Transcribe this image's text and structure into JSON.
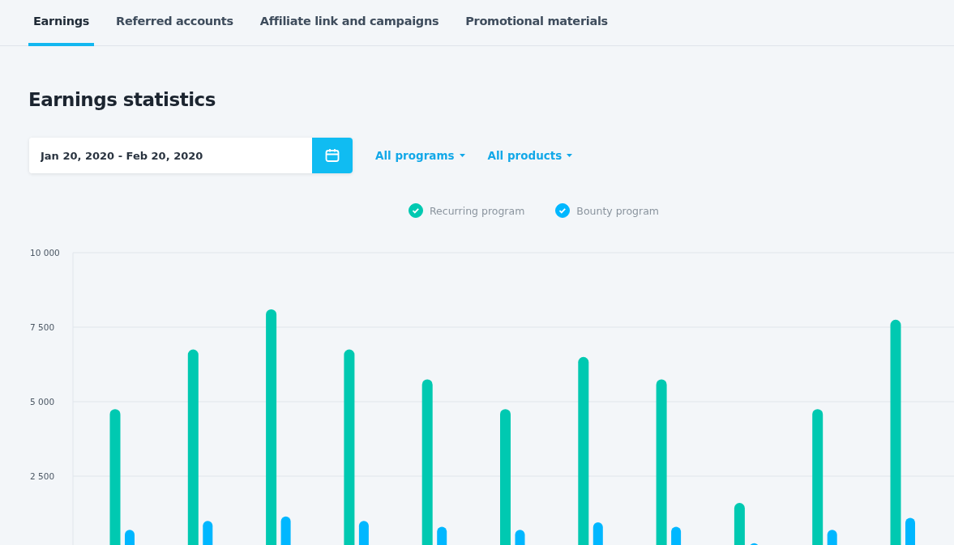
{
  "tabs": [
    {
      "label": "Earnings",
      "selected": true
    },
    {
      "label": "Referred accounts",
      "selected": false
    },
    {
      "label": "Affiliate link and campaigns",
      "selected": false
    },
    {
      "label": "Promotional materials",
      "selected": false
    }
  ],
  "heading": "Earnings statistics",
  "date_range": {
    "value": "Jan 20, 2020 - Feb 20, 2020"
  },
  "filters": [
    {
      "label": "All programs"
    },
    {
      "label": "All products"
    }
  ],
  "legend": [
    {
      "checked": true
    },
    {
      "checked": true
    }
  ],
  "chart_data": {
    "type": "bar",
    "grid": true,
    "ylim": [
      0,
      10000
    ],
    "yticks": [
      {
        "value": 2500,
        "label": "2 500"
      },
      {
        "value": 5000,
        "label": "5 000"
      },
      {
        "value": 7500,
        "label": "7 500"
      },
      {
        "value": 10000,
        "label": "10 000"
      }
    ],
    "series": [
      {
        "name": "Recurring program",
        "color": "#00c9b1",
        "values": [
          4750,
          6750,
          8100,
          6750,
          5750,
          4750,
          6500,
          5750,
          1600,
          4750,
          7750
        ]
      },
      {
        "name": "Bounty program",
        "color": "#00b7ff",
        "values": [
          700,
          1000,
          1150,
          1000,
          800,
          700,
          950,
          800,
          250,
          700,
          1100
        ]
      }
    ]
  }
}
